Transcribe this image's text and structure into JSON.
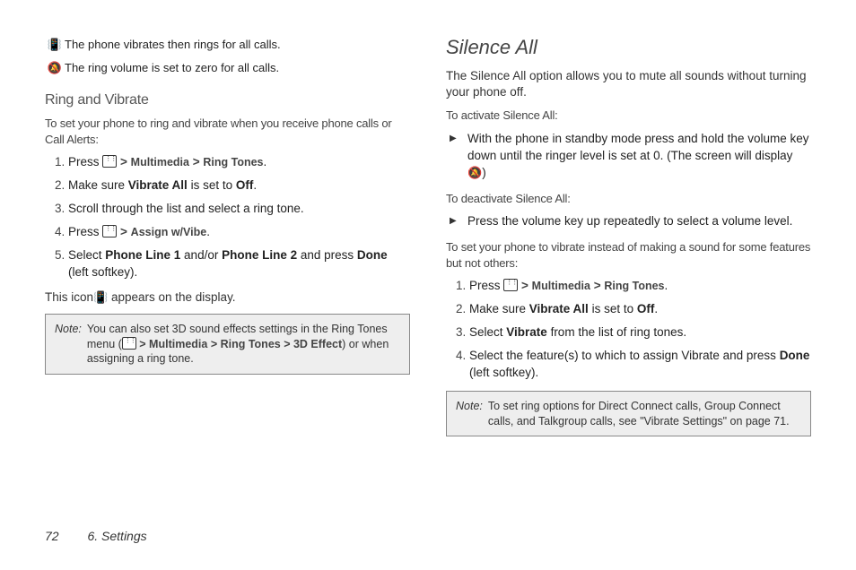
{
  "left": {
    "icon_rows": [
      {
        "icon": "📳",
        "text": "The phone vibrates then rings for all calls."
      },
      {
        "icon": "🔕",
        "text": "The ring volume is set to zero for all calls."
      }
    ],
    "h_ring_vibrate": "Ring and Vibrate",
    "intro": "To set your phone to ring and vibrate when you receive phone calls or Call Alerts:",
    "steps": {
      "s1_a": "Press ",
      "s1_b_menu": "Multimedia",
      "s1_c_menu": "Ring Tones",
      "s2_a": "Make sure ",
      "s2_b": "Vibrate All",
      "s2_c": " is set to ",
      "s2_d": "Off",
      "s2_e": ".",
      "s3": "Scroll through the list and select a ring tone.",
      "s4_a": "Press ",
      "s4_b_menu": "Assign w/Vibe",
      "s5_a": "Select ",
      "s5_b": "Phone Line 1",
      "s5_c": " and/or ",
      "s5_d": "Phone Line 2",
      "s5_e": " and press ",
      "s5_f": "Done",
      "s5_g": " (left softkey)."
    },
    "icon_line_a": "This icon",
    "icon_line_b": " appears on the display.",
    "note_label": "Note:",
    "note_a": "You can also set 3D sound effects settings in the Ring Tones menu (",
    "note_menu1": "Multimedia",
    "note_menu2": "Ring Tones",
    "note_menu3": "3D Effect",
    "note_b": ") or when assigning a ring tone."
  },
  "right": {
    "h_silence": "Silence All",
    "intro": "The Silence All option allows you to mute all sounds without turning your phone off.",
    "activate_lead": "To activate Silence All:",
    "activate_item_a": "With the phone in standby mode press and hold the volume key down until the ringer level is set at 0. (The screen will display ",
    "activate_item_b": ")",
    "deactivate_lead": "To deactivate Silence All:",
    "deactivate_item": "Press the volume key up repeatedly to select a volume level.",
    "vibrate_lead": "To set your phone to vibrate instead of making a sound for some features but not others:",
    "steps": {
      "s1_a": "Press ",
      "s1_b_menu": "Multimedia",
      "s1_c_menu": "Ring Tones",
      "s2_a": "Make sure ",
      "s2_b": "Vibrate All",
      "s2_c": " is set to ",
      "s2_d": "Off",
      "s2_e": ".",
      "s3_a": "Select ",
      "s3_b": "Vibrate",
      "s3_c": " from the list of ring tones.",
      "s4_a": "Select the feature(s) to which to assign Vibrate and press ",
      "s4_b": "Done",
      "s4_c": " (left softkey)."
    },
    "note_label": "Note:",
    "note_text": "To set ring options for Direct Connect calls, Group Connect calls, and Talkgroup calls, see \"Vibrate Settings\" on page 71."
  },
  "footer": {
    "page": "72",
    "chapter": "6. Settings"
  }
}
